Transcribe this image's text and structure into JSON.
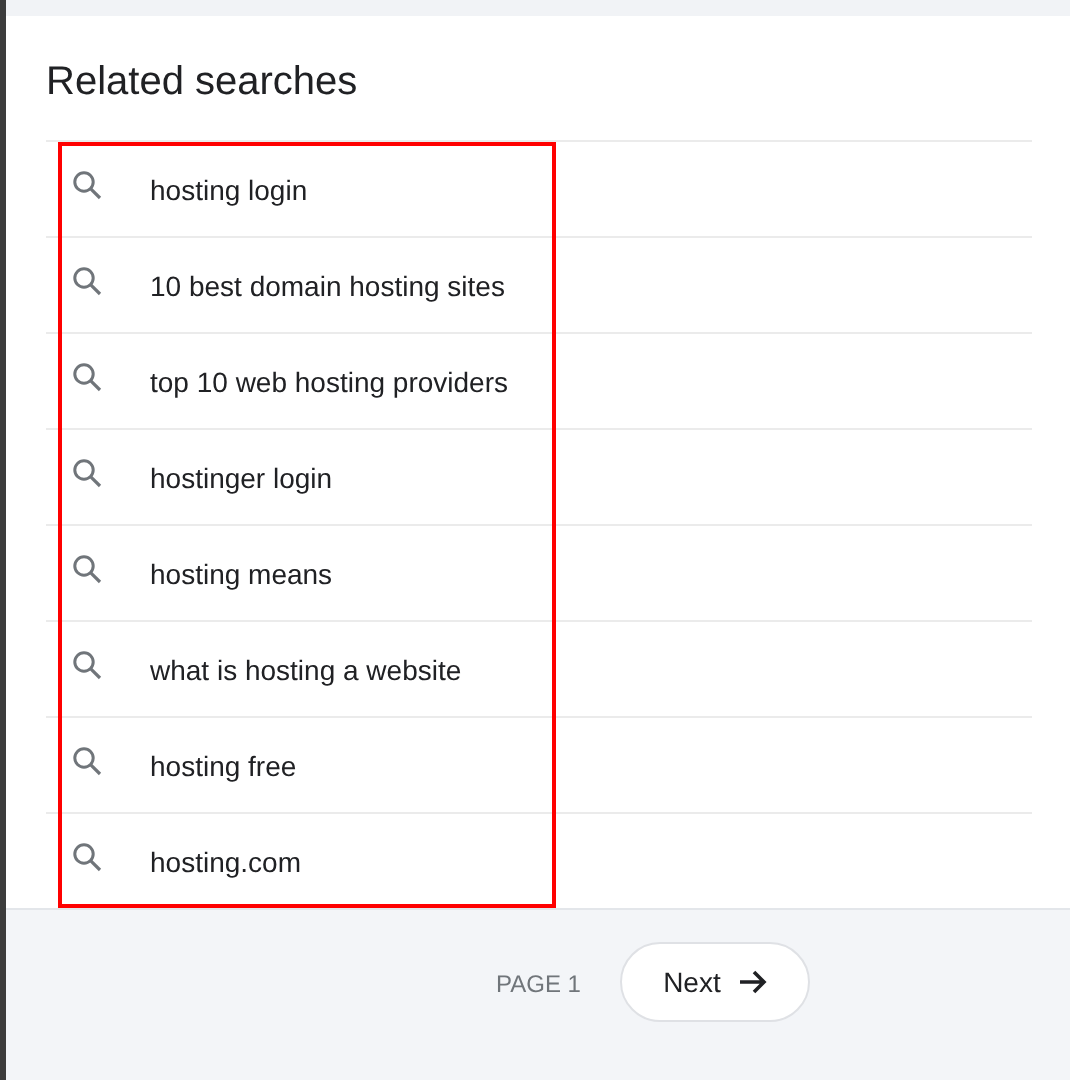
{
  "title": "Related searches",
  "highlighted": true,
  "searches": [
    {
      "text": "hosting login"
    },
    {
      "text": "10 best domain hosting sites"
    },
    {
      "text": "top 10 web hosting providers"
    },
    {
      "text": "hostinger login"
    },
    {
      "text": "hosting means"
    },
    {
      "text": "what is hosting a website"
    },
    {
      "text": "hosting free"
    },
    {
      "text": "hosting.com"
    }
  ],
  "footer": {
    "page": "PAGE 1",
    "next": "Next"
  }
}
